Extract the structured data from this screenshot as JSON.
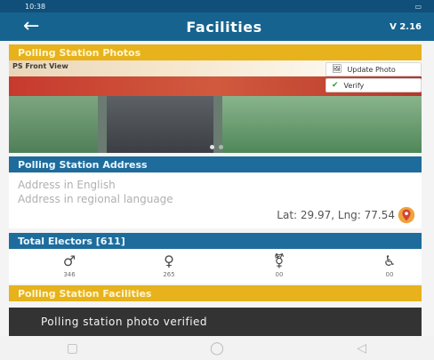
{
  "status_bar": {
    "time": "10:38"
  },
  "app_bar": {
    "title": "Facilities",
    "version": "V 2.16"
  },
  "sections": {
    "photos": "Polling Station Photos",
    "address": "Polling Station Address",
    "electors": "Total Electors [611]",
    "facilities": "Polling Station Facilities"
  },
  "photo": {
    "caption": "PS Front View",
    "update_label": "Update Photo",
    "verify_label": "Verify"
  },
  "address": {
    "english_placeholder": "Address in English",
    "regional_placeholder": "Address in regional language",
    "latlng": "Lat: 29.97, Lng: 77.54"
  },
  "electors_stats": [
    {
      "icon": "male-icon",
      "value": "346"
    },
    {
      "icon": "female-icon",
      "value": "265"
    },
    {
      "icon": "third-gender-icon",
      "value": "00"
    },
    {
      "icon": "wheelchair-icon",
      "value": "00"
    }
  ],
  "toast": "Polling station photo verified",
  "colors": {
    "primary_blue": "#16638f",
    "section_blue": "#1e6c9c",
    "section_yellow": "#e7b21c",
    "toast_bg": "#333333",
    "verify_green": "#2e9f3b",
    "pin_orange": "#f0a23a",
    "pin_red": "#d0453a"
  }
}
